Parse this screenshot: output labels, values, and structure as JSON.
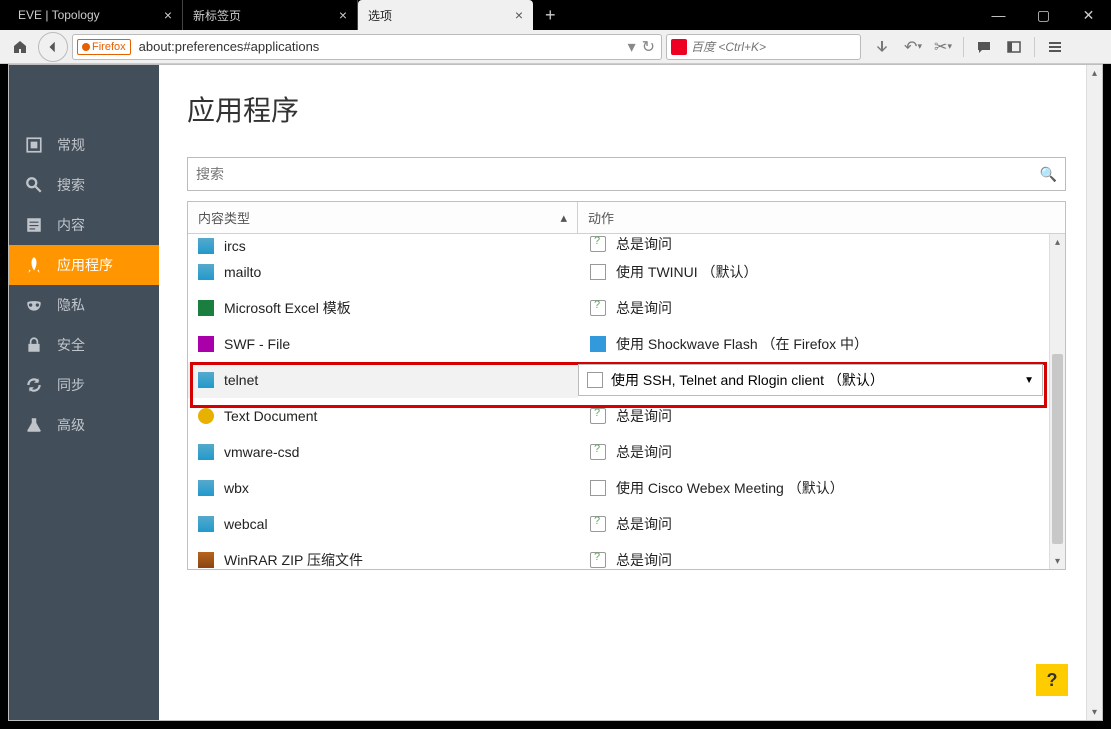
{
  "window": {
    "tabs": [
      {
        "label": "EVE | Topology",
        "active": false
      },
      {
        "label": "新标签页",
        "active": false
      },
      {
        "label": "选项",
        "active": true
      }
    ]
  },
  "toolbar": {
    "identity_badge": "Firefox",
    "url": "about:preferences#applications",
    "search_placeholder": "百度 <Ctrl+K>"
  },
  "sidebar": {
    "items": [
      {
        "label": "常规"
      },
      {
        "label": "搜索"
      },
      {
        "label": "内容"
      },
      {
        "label": "应用程序"
      },
      {
        "label": "隐私"
      },
      {
        "label": "安全"
      },
      {
        "label": "同步"
      },
      {
        "label": "高级"
      }
    ],
    "selected_index": 3
  },
  "main": {
    "title": "应用程序",
    "search_placeholder": "搜索",
    "columns": {
      "type": "内容类型",
      "action": "动作"
    },
    "rows": [
      {
        "type": "ircs",
        "action": "总是询问",
        "action_icon": "ask"
      },
      {
        "type": "mailto",
        "action": "使用 TWINUI （默认）",
        "action_icon": "app"
      },
      {
        "type": "Microsoft Excel 模板",
        "action": "总是询问",
        "type_icon": "excel",
        "action_icon": "ask"
      },
      {
        "type": "SWF - File",
        "action": "使用 Shockwave Flash （在 Firefox 中）",
        "type_icon": "swf",
        "action_icon": "plugin"
      },
      {
        "type": "telnet",
        "action": "使用 SSH, Telnet and Rlogin client （默认）",
        "selected": true,
        "action_icon": "app"
      },
      {
        "type": "Text Document",
        "action": "总是询问",
        "type_icon": "txt",
        "action_icon": "ask"
      },
      {
        "type": "vmware-csd",
        "action": "总是询问",
        "action_icon": "ask"
      },
      {
        "type": "wbx",
        "action": "使用 Cisco Webex Meeting （默认）",
        "action_icon": "app"
      },
      {
        "type": "webcal",
        "action": "总是询问",
        "action_icon": "ask"
      },
      {
        "type": "WinRAR ZIP 压缩文件",
        "action": "总是询问",
        "type_icon": "rar",
        "action_icon": "ask"
      }
    ],
    "help_label": "?"
  }
}
